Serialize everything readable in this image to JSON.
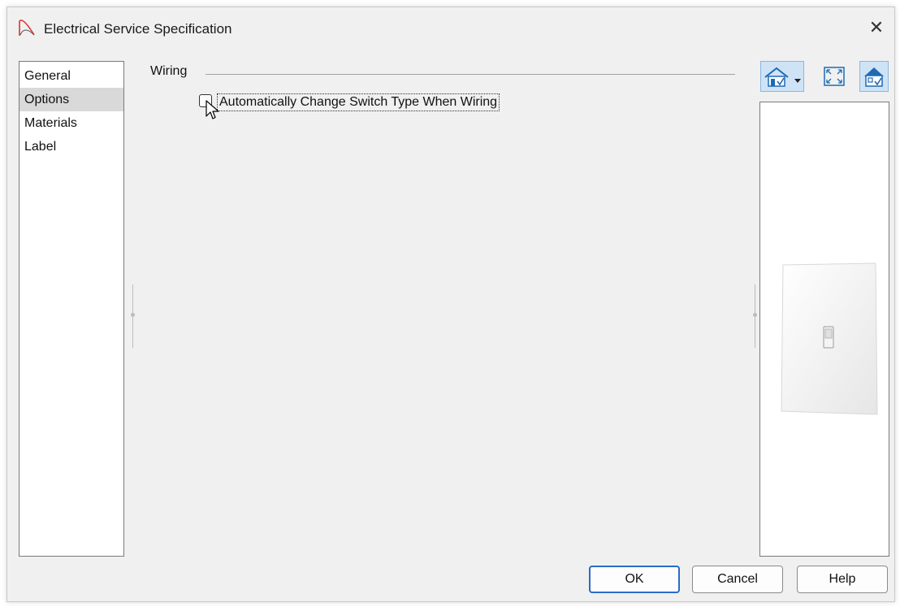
{
  "window": {
    "title": "Electrical Service Specification",
    "close_glyph": "✕"
  },
  "nav": {
    "items": [
      "General",
      "Options",
      "Materials",
      "Label"
    ],
    "selected": "Options"
  },
  "wiring": {
    "group_title": "Wiring",
    "auto_change_switch": {
      "label": "Automatically Change Switch Type When Wiring",
      "checked": false
    }
  },
  "preview_toolbar": {
    "icons": [
      "house-view-icon",
      "dropdown-arrow-icon",
      "fill-window-icon",
      "house-color-icon"
    ]
  },
  "buttons": {
    "ok": "OK",
    "cancel": "Cancel",
    "help": "Help"
  },
  "colors": {
    "accent": "#2a6cc8",
    "logo": "#e03030",
    "toolbar_active": "#cfe3f7"
  }
}
